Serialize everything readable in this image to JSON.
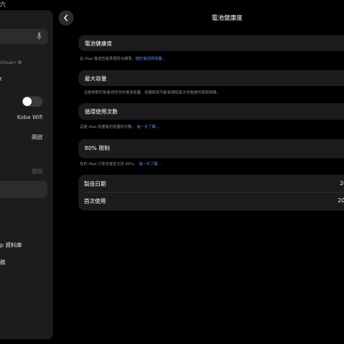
{
  "status_bar": {
    "day": "六"
  },
  "sidebar": {
    "search_hint_fragment": "iCloud+ 與",
    "account_fragment": "t",
    "wifi_value": "Kobe Wifi",
    "bluetooth_value": "開啟",
    "dim_value": "關閉",
    "library_fragment": "p 資料庫",
    "services_fragment": "務"
  },
  "header": {
    "title": "電池健康度"
  },
  "battery_health": {
    "label": "電池健康度",
    "footnote": "此 iPad 電池性能表現符合標準。",
    "footnote_link": "關於電池與保養…"
  },
  "max_capacity": {
    "label": "最大容量",
    "footnote": "這是相對於新電池而言的電池容量。容量較低可能會縮短每次充電後的使用時間。"
  },
  "cycle_count": {
    "label": "循環使用次數",
    "footnote": "這是 iPad 用盡電池容量的次數。",
    "footnote_link": "進一步了解…"
  },
  "limit_80": {
    "label": "80% 限制",
    "footnote": "你的 iPad 只會充電至大約 80%。",
    "footnote_link": "進一步了解…"
  },
  "info": {
    "manufacture_label": "製造日期",
    "manufacture_value": "20",
    "first_use_label": "首次使用",
    "first_use_value": "20"
  }
}
